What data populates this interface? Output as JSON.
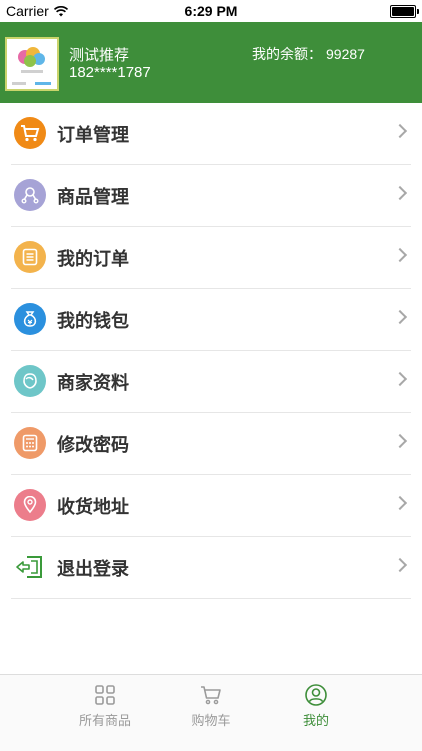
{
  "status_bar": {
    "carrier": "Carrier",
    "time": "6:29 PM"
  },
  "header": {
    "user_name": "测试推荐",
    "phone": "182****1787",
    "balance_label": "我的余额：",
    "balance_value": "99287"
  },
  "menu": [
    {
      "label": "订单管理",
      "icon": "cart-icon",
      "color": "#f08a16"
    },
    {
      "label": "商品管理",
      "icon": "share-nodes-icon",
      "color": "#a6a3d6"
    },
    {
      "label": "我的订单",
      "icon": "list-doc-icon",
      "color": "#f3b34c"
    },
    {
      "label": "我的钱包",
      "icon": "money-bag-icon",
      "color": "#2b90de"
    },
    {
      "label": "商家资料",
      "icon": "profile-face-icon",
      "color": "#6ec6c8"
    },
    {
      "label": "修改密码",
      "icon": "keypad-icon",
      "color": "#ef9a68"
    },
    {
      "label": "收货地址",
      "icon": "location-pin-icon",
      "color": "#ec7d8b"
    },
    {
      "label": "退出登录",
      "icon": "logout-icon",
      "color": "#3a9a3a"
    }
  ],
  "tabbar": {
    "tabs": [
      {
        "label": "所有商品",
        "icon": "grid-icon"
      },
      {
        "label": "购物车",
        "icon": "cart-outline-icon"
      },
      {
        "label": "我的",
        "icon": "user-circle-icon"
      }
    ],
    "active_index": 2
  }
}
